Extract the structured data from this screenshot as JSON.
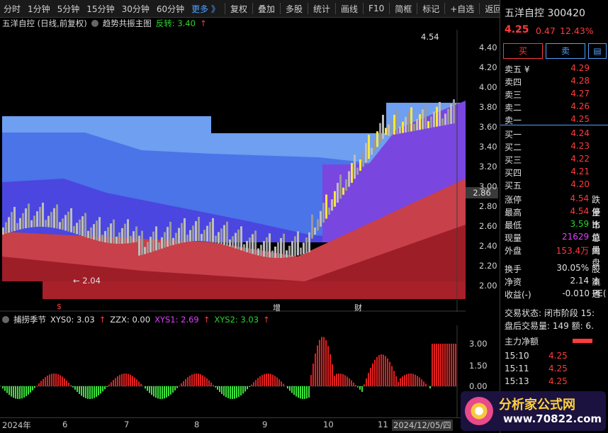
{
  "toolbar": {
    "left": [
      "分时",
      "1分钟",
      "5分钟",
      "15分钟",
      "30分钟",
      "60分钟"
    ],
    "more": "更多 》",
    "right": [
      "复权",
      "叠加",
      "多股",
      "统计",
      "画线",
      "F10",
      "简框",
      "标记",
      "+自选",
      "返回"
    ]
  },
  "header": {
    "title": "五洋自控 (日线,前复权)",
    "indicator": "趋势共振主图",
    "reversal": "反转: 3.40",
    "arrow": "↑"
  },
  "price_axis": [
    "4.40",
    "4.20",
    "4.00",
    "3.80",
    "3.60",
    "3.40",
    "3.20",
    "3.00",
    "2.80",
    "2.60",
    "2.40",
    "2.20",
    "2.00"
  ],
  "current_price_tag": "2.86",
  "annotations": {
    "high": "4.54",
    "low": "2.04",
    "markers": [
      "$",
      "增",
      "财"
    ]
  },
  "sub": {
    "indicator": "捕捞季节",
    "xys0": "XYS0: 3.03",
    "zzx": "ZZX: 0.00",
    "xys1": "XYS1: 2.69",
    "xys2": "XYS2: 3.03",
    "axis": [
      "3.00",
      "1.50",
      "0.00"
    ]
  },
  "xaxis": [
    "2024年",
    "6",
    "7",
    "8",
    "9",
    "10",
    "11",
    "2024/12/05/四"
  ],
  "panel": {
    "name": "五洋自控",
    "code": "300420",
    "price": "4.25",
    "change": "0.47",
    "pct": "12.43%",
    "buy_label": "买",
    "sell_label": "卖",
    "asks": [
      {
        "label": "卖五 ¥",
        "price": "4.29"
      },
      {
        "label": "卖四",
        "price": "4.28"
      },
      {
        "label": "卖三",
        "price": "4.27"
      },
      {
        "label": "卖二",
        "price": "4.26"
      },
      {
        "label": "卖一",
        "price": "4.25"
      }
    ],
    "bids": [
      {
        "label": "买一",
        "price": "4.24"
      },
      {
        "label": "买二",
        "price": "4.23"
      },
      {
        "label": "买三",
        "price": "4.22"
      },
      {
        "label": "买四",
        "price": "4.21"
      },
      {
        "label": "买五",
        "price": "4.20"
      }
    ],
    "stats": [
      {
        "k": "涨停",
        "v": "4.54",
        "k2": "跌停"
      },
      {
        "k": "最高",
        "v": "4.54",
        "k2": "量比"
      },
      {
        "k": "最低",
        "v": "3.59",
        "k2": "市值"
      },
      {
        "k": "现量",
        "v": "21629",
        "k2": "总量"
      },
      {
        "k": "外盘",
        "v": "153.4万",
        "k2": "内盘"
      }
    ],
    "stats2": [
      {
        "k": "换手",
        "v": "30.05%",
        "k2": "股本"
      },
      {
        "k": "净资",
        "v": "2.14",
        "k2": "流通"
      },
      {
        "k": "收益(-)",
        "v": "-0.010",
        "k2": "PE("
      }
    ],
    "status": "交易状态: 闭市阶段 15:",
    "after": "盘后交易量: 149  额: 6.",
    "mainflow": "主力净额",
    "ticks": [
      {
        "t": "15:10",
        "p": "4.25"
      },
      {
        "t": "15:11",
        "p": "4.25"
      },
      {
        "t": "15:13",
        "p": "4.25"
      }
    ]
  },
  "watermark": "分析家公式网www.70822.com",
  "logo": {
    "name": "分析家公式网",
    "url": "www.70822.com"
  }
}
